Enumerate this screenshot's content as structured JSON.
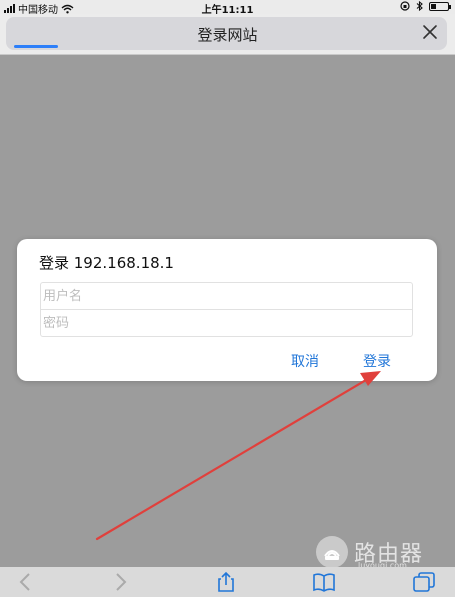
{
  "status_bar": {
    "carrier": "中国移动",
    "time": "上午11:11",
    "battery_level": 0.3
  },
  "nav": {
    "title": "登录网站",
    "load_progress": 0.1,
    "close_icon": "close-icon"
  },
  "dialog": {
    "title": "登录 192.168.18.1",
    "username_placeholder": "用户名",
    "password_placeholder": "密码",
    "cancel_label": "取消",
    "login_label": "登录"
  },
  "watermark": {
    "text": "路由器",
    "sub": "luyouqi.com"
  },
  "toolbar": {
    "icons": [
      "back-icon",
      "forward-icon",
      "share-icon",
      "bookmarks-icon",
      "tabs-icon"
    ]
  },
  "colors": {
    "accent": "#2176d8",
    "arrow": "#e0403c",
    "overlay": "#9c9c9c"
  }
}
